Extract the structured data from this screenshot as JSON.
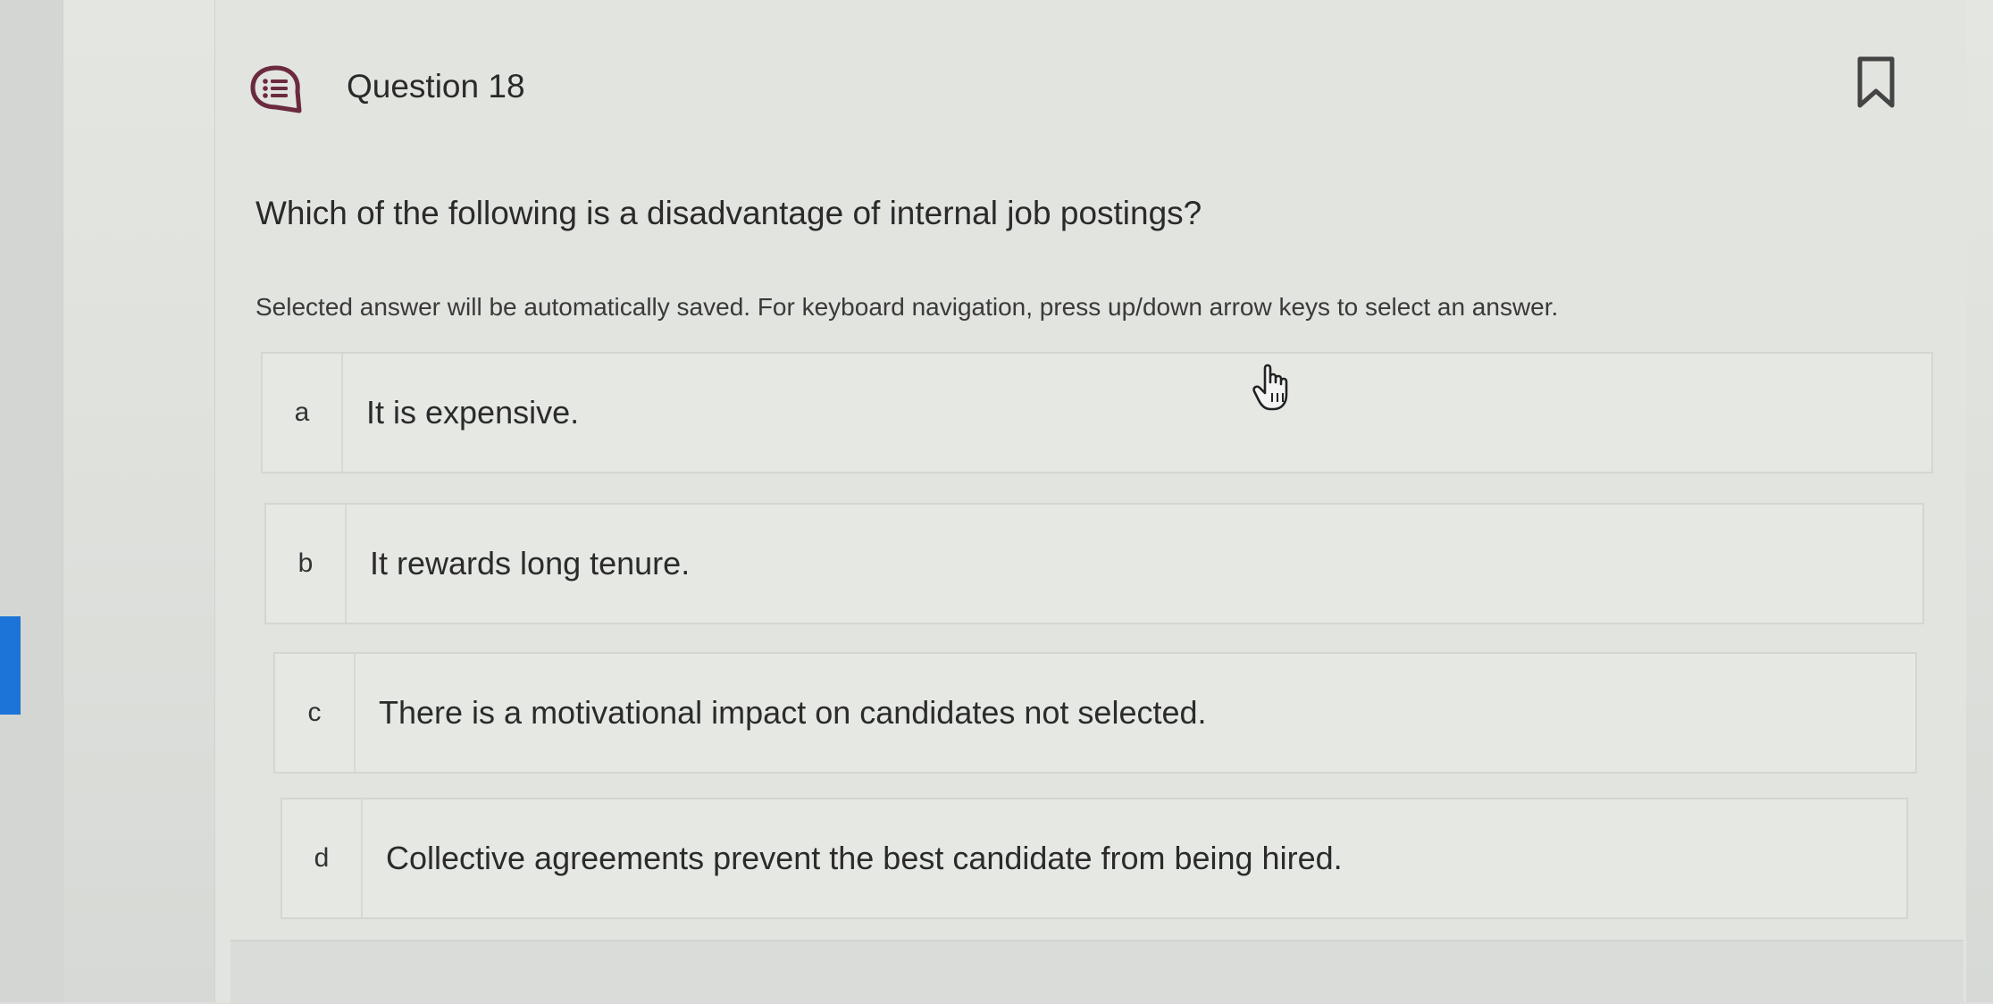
{
  "question": {
    "title": "Question 18",
    "text": "Which of the following is a disadvantage of internal job postings?",
    "instructions": "Selected answer will be automatically saved. For keyboard navigation, press up/down arrow keys to select an answer.",
    "icon": "question-list-bubble-icon",
    "bookmark_icon": "bookmark-icon"
  },
  "options": [
    {
      "letter": "a",
      "text": "It is expensive."
    },
    {
      "letter": "b",
      "text": "It rewards long tenure."
    },
    {
      "letter": "c",
      "text": "There is a motivational impact on candidates not selected."
    },
    {
      "letter": "d",
      "text": "Collective agreements prevent the best candidate from being hired."
    }
  ],
  "colors": {
    "accent": "#1c74d8",
    "icon": "#6b2a3e"
  }
}
